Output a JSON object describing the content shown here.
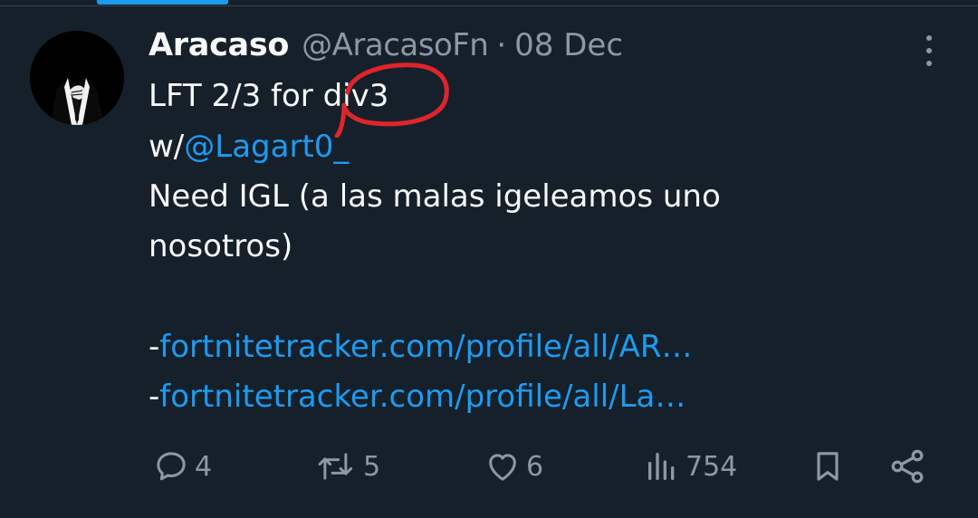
{
  "tweet": {
    "author_name": "Aracaso",
    "author_handle": "@AracasoFn",
    "separator": "·",
    "date": "08 Dec",
    "lines": {
      "l1_prefix": "LFT 2/3 for ",
      "l1_circled": "div3",
      "l2_prefix": "w/",
      "l2_mention": "@Lagart0_",
      "l3": "Need IGL (a las malas igeleamos uno",
      "l4": "nosotros)",
      "l5_prefix": "-",
      "l5_link": "fortnitetracker.com/profile/all/AR…",
      "l6_prefix": "-",
      "l6_link": "fortnitetracker.com/profile/all/La…"
    }
  },
  "actions": {
    "replies": "4",
    "retweets": "5",
    "likes": "6",
    "views": "754"
  },
  "colors": {
    "background": "#15202b",
    "text": "#f7f9f9",
    "muted": "#8b98a5",
    "link": "#1d9bf0",
    "annotation": "#e0242b"
  },
  "icons": {
    "reply": "reply-icon",
    "retweet": "retweet-icon",
    "like": "heart-icon",
    "views": "views-icon",
    "bookmark": "bookmark-icon",
    "share": "share-icon",
    "more": "more-icon"
  }
}
